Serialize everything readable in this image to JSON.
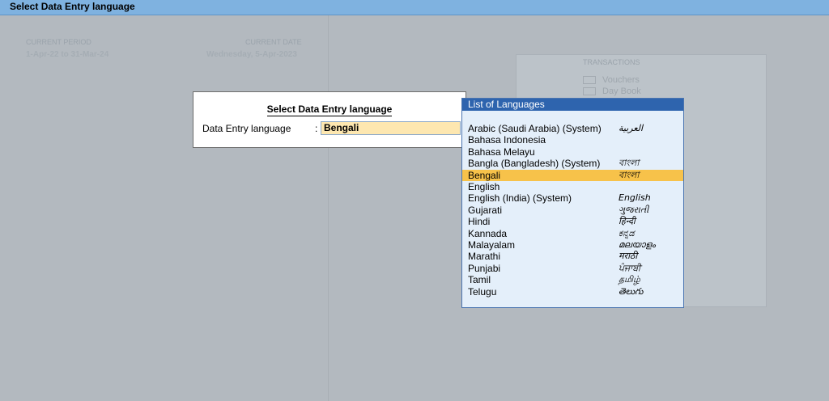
{
  "window": {
    "title": "Select Data Entry language"
  },
  "background": {
    "current_period_label": "CURRENT PERIOD",
    "current_period_value": "1-Apr-22 to 31-Mar-24",
    "current_date_label": "CURRENT DATE",
    "current_date_value": "Wednesday, 5-Apr-2023",
    "transactions_heading": "TRANSACTIONS",
    "transactions_items": [
      "Vouchers",
      "Day Book"
    ]
  },
  "dialog": {
    "title": "Select Data Entry language",
    "field_label": "Data Entry language",
    "field_value": "Bengali"
  },
  "list": {
    "header": "List of Languages",
    "selected_index": 4,
    "items": [
      {
        "name": "Arabic (Saudi Arabia) (System)",
        "native": "العربية"
      },
      {
        "name": "Bahasa Indonesia",
        "native": ""
      },
      {
        "name": "Bahasa Melayu",
        "native": ""
      },
      {
        "name": "Bangla (Bangladesh) (System)",
        "native": "বাংলা"
      },
      {
        "name": "Bengali",
        "native": "বাংলা"
      },
      {
        "name": "English",
        "native": ""
      },
      {
        "name": "English (India) (System)",
        "native": "English"
      },
      {
        "name": "Gujarati",
        "native": "ગુજરાતી"
      },
      {
        "name": "Hindi",
        "native": "हिन्दी"
      },
      {
        "name": "Kannada",
        "native": "ಕನ್ನಡ"
      },
      {
        "name": "Malayalam",
        "native": "മലയാളം"
      },
      {
        "name": "Marathi",
        "native": "मराठी"
      },
      {
        "name": "Punjabi",
        "native": "ਪੰਜਾਬੀ"
      },
      {
        "name": "Tamil",
        "native": "தமிழ்"
      },
      {
        "name": "Telugu",
        "native": "తెలుగు"
      }
    ]
  }
}
